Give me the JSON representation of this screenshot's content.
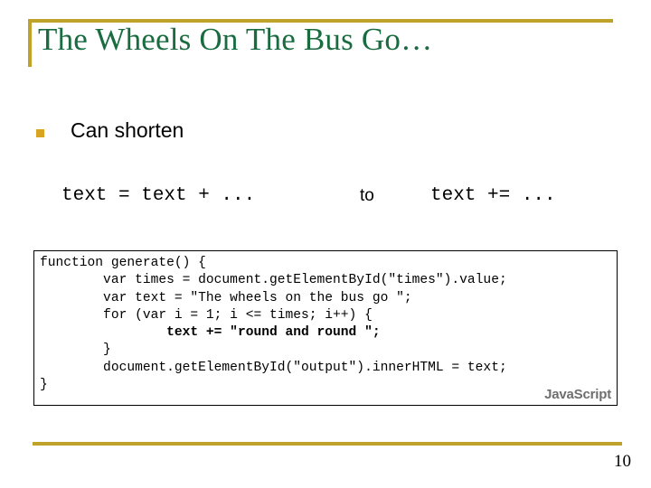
{
  "slide": {
    "title": "The Wheels On The Bus Go…",
    "page_number": "10",
    "accent_color": "#bfa22a",
    "title_color": "#1a6b40",
    "bullet_color": "#d9a520"
  },
  "bullet": {
    "marker": "square-bullet",
    "text": "Can shorten"
  },
  "expression": {
    "left": "text = text + ...",
    "connector": "to",
    "right": "text += ..."
  },
  "code": {
    "language_label": "JavaScript",
    "language_label_color": "#6e6e6e",
    "lines": [
      {
        "text": "function generate() {",
        "bold": false
      },
      {
        "text": "        var times = document.getElementById(\"times\").value;",
        "bold": false
      },
      {
        "text": "        var text = \"The wheels on the bus go \";",
        "bold": false
      },
      {
        "text": "        for (var i = 1; i <= times; i++) {",
        "bold": false
      },
      {
        "text": "                text += \"round and round \";",
        "bold": true
      },
      {
        "text": "        }",
        "bold": false
      },
      {
        "text": "        document.getElementById(\"output\").innerHTML = text;",
        "bold": false
      },
      {
        "text": "}",
        "bold": false
      }
    ]
  }
}
